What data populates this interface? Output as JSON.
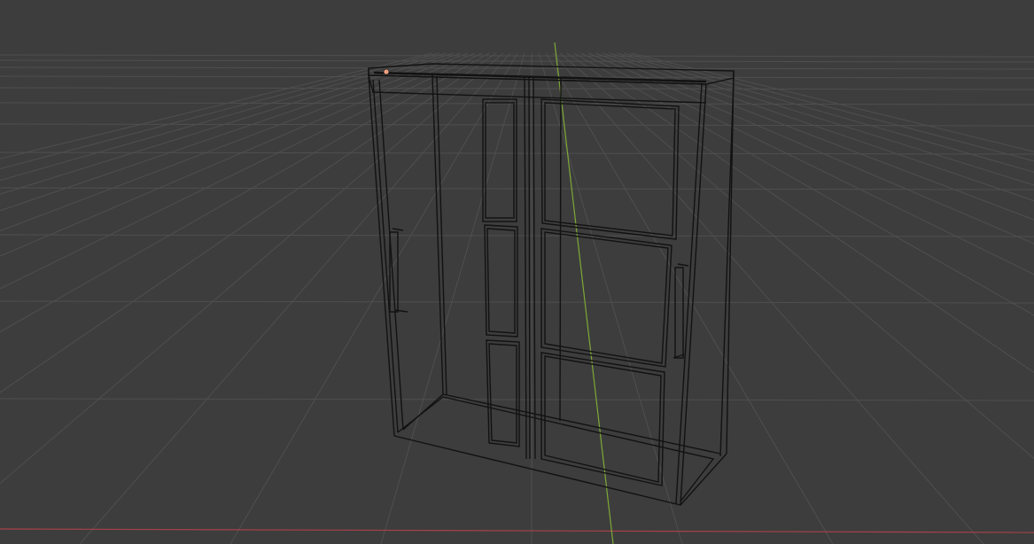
{
  "viewport": {
    "mode": "wireframe",
    "colors": {
      "background": "#3d3d3d",
      "grid": "#4f4f4f",
      "x_axis": "#a8414a",
      "y_axis": "#7ea838",
      "wire": "#121212",
      "origin": "#f0a080"
    },
    "icons": [
      "origin-point-icon"
    ]
  }
}
